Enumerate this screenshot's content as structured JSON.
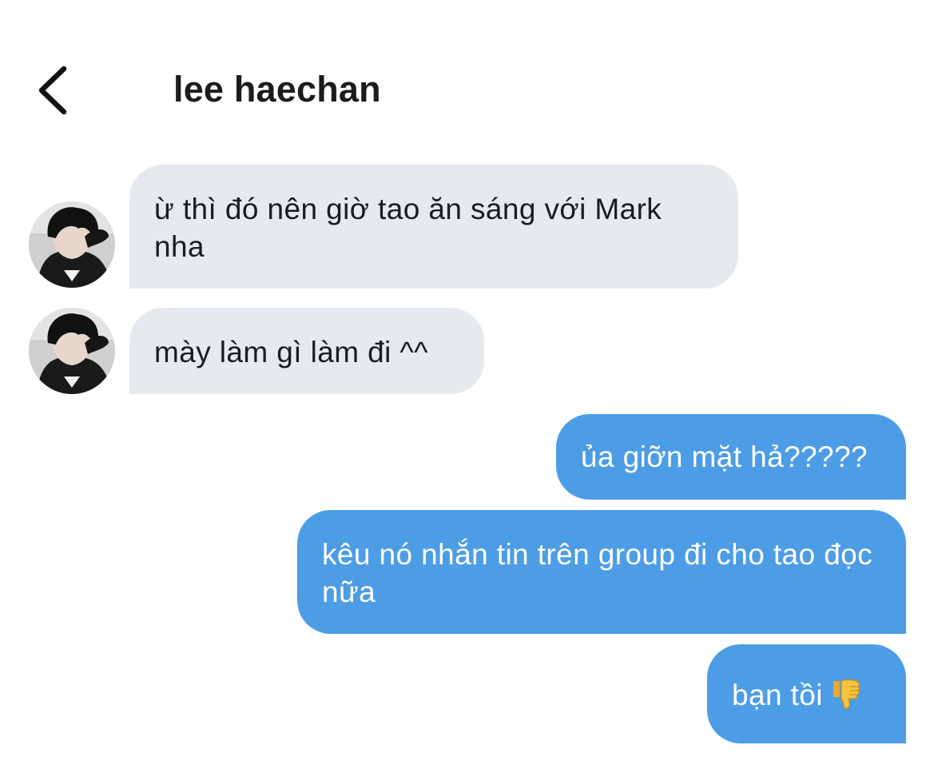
{
  "header": {
    "back_icon": "chevron-left-icon",
    "title": "lee haechan"
  },
  "messages": [
    {
      "direction": "incoming",
      "text": "ừ thì đó nên giờ tao ăn sáng với Mark nha"
    },
    {
      "direction": "incoming",
      "text": "mày làm gì làm đi ^^"
    },
    {
      "direction": "outgoing",
      "text": "ủa giỡn mặt hả?????"
    },
    {
      "direction": "outgoing",
      "text": "kêu nó nhắn tin trên group đi cho tao đọc nữa"
    },
    {
      "direction": "outgoing",
      "text": "bạn tồi",
      "emoji": "thumbs-down-icon"
    }
  ],
  "colors": {
    "incoming_bubble": "#e6eaee",
    "outgoing_bubble": "#4d9de6",
    "text_dark": "#1c1c1e",
    "text_light": "#ffffff"
  }
}
